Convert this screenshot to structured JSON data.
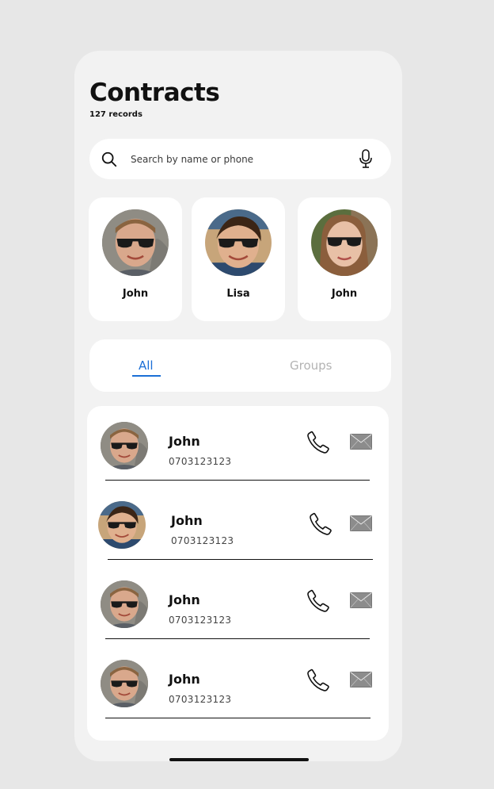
{
  "header": {
    "title": "Contracts",
    "subtitle": "127 records"
  },
  "search": {
    "placeholder": "Search by name or phone",
    "value": ""
  },
  "favorites": [
    {
      "name": "John"
    },
    {
      "name": "Lisa"
    },
    {
      "name": "John"
    }
  ],
  "tabs": [
    {
      "label": "All",
      "active": true
    },
    {
      "label": "Groups",
      "active": false
    }
  ],
  "contacts": [
    {
      "name": "John",
      "phone": "0703123123"
    },
    {
      "name": "John",
      "phone": "0703123123"
    },
    {
      "name": "John",
      "phone": "0703123123"
    },
    {
      "name": "John",
      "phone": "0703123123"
    }
  ],
  "colors": {
    "accent": "#1b6fd6",
    "inactive_tab": "#b3b3b3",
    "card": "#ffffff",
    "screen": "#f2f2f2",
    "page": "#e7e7e7"
  }
}
